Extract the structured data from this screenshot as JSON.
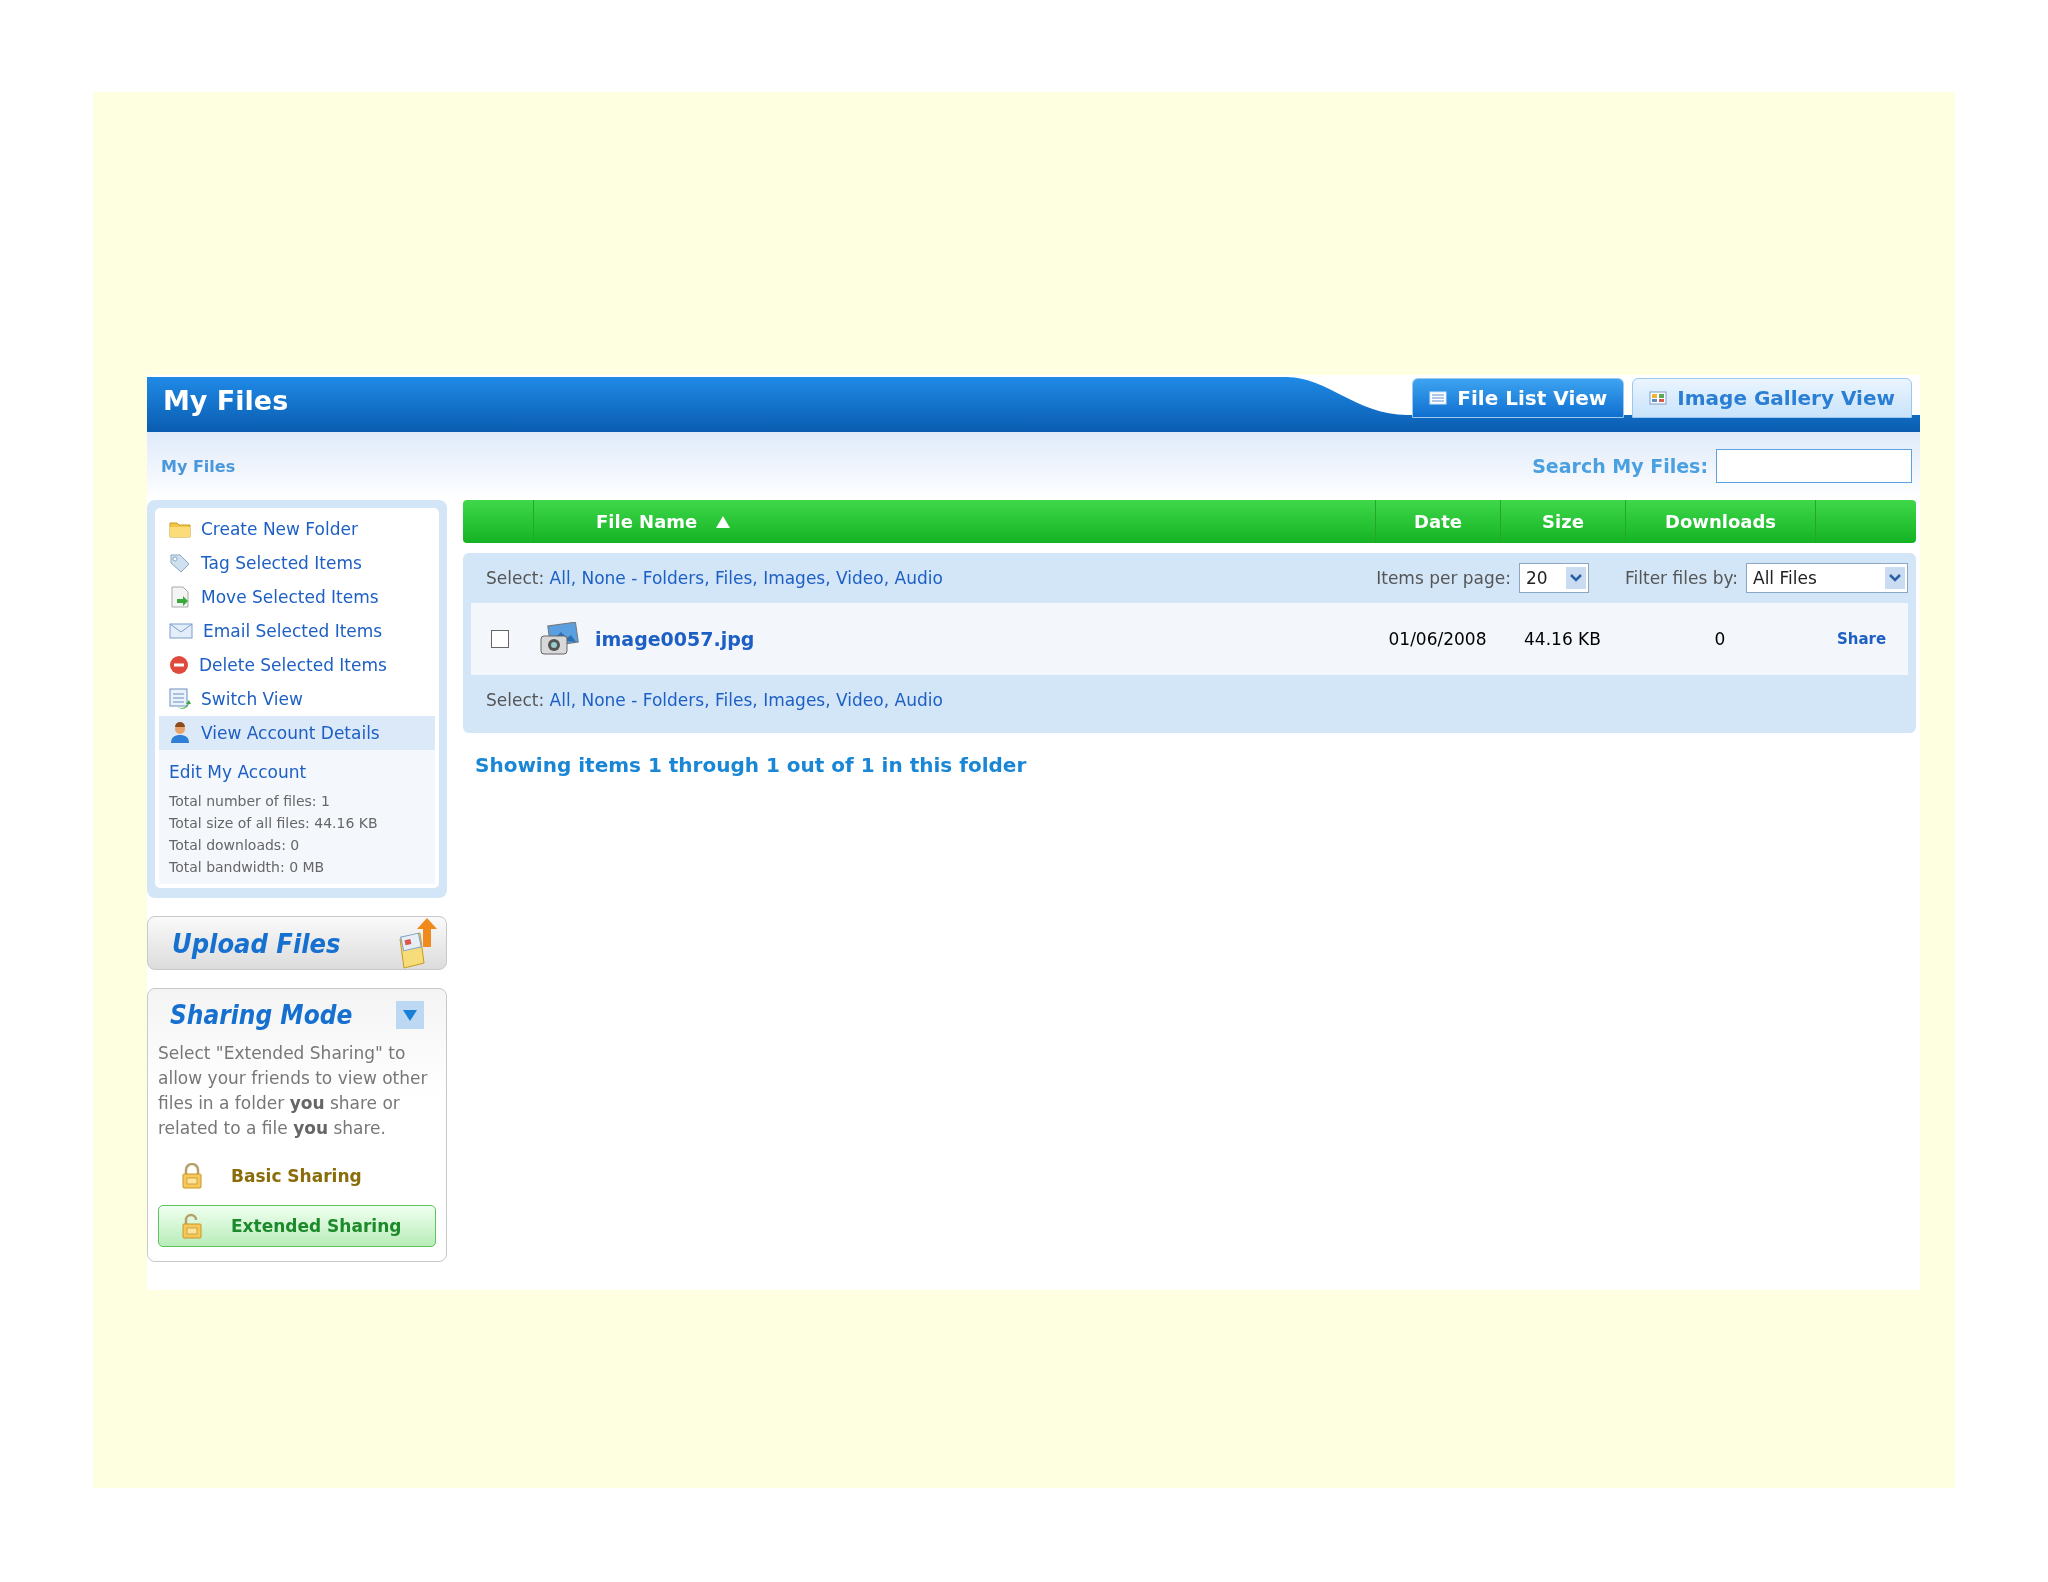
{
  "header": {
    "title": "My Files"
  },
  "tabs": [
    {
      "label": "File List View",
      "selected": true
    },
    {
      "label": "Image Gallery View",
      "selected": false
    }
  ],
  "breadcrumb": "My Files",
  "search": {
    "label": "Search My Files:"
  },
  "sidebar": {
    "items": [
      {
        "label": "Create New Folder",
        "selected": false
      },
      {
        "label": "Tag Selected Items",
        "selected": false
      },
      {
        "label": "Move Selected Items",
        "selected": false
      },
      {
        "label": "Email Selected Items",
        "selected": false
      },
      {
        "label": "Delete Selected Items",
        "selected": false
      },
      {
        "label": "Switch View",
        "selected": false
      },
      {
        "label": "View Account Details",
        "selected": true
      }
    ],
    "account": {
      "link": "Edit My Account",
      "stats": [
        "Total number of files: 1",
        "Total size of all files: 44.16 KB",
        "Total downloads: 0",
        "Total bandwidth: 0 MB"
      ]
    }
  },
  "upload_button": "Upload Files",
  "sharing": {
    "title": "Sharing Mode",
    "description": "Select \"Extended Sharing\" to allow your friends to view other files in a folder **you** share or related to a file **you** share.",
    "options": [
      {
        "label": "Basic Sharing",
        "selected": false
      },
      {
        "label": "Extended Sharing",
        "selected": true
      }
    ]
  },
  "table": {
    "columns": [
      {
        "label": "File Name"
      },
      {
        "label": "Date"
      },
      {
        "label": "Size"
      },
      {
        "label": "Downloads"
      }
    ],
    "select_bars": [
      {
        "label": "Select:",
        "groups": [
          [
            "All",
            "None"
          ],
          [
            "Folders",
            "Files",
            "Images",
            "Video",
            "Audio"
          ]
        ],
        "separator": ",",
        "group_separator": "-"
      },
      {
        "label": "Select:",
        "groups": [
          [
            "All",
            "None"
          ],
          [
            "Folders",
            "Files",
            "Images",
            "Video",
            "Audio"
          ]
        ],
        "separator": ",",
        "group_separator": "-"
      }
    ],
    "items_per_page": {
      "label": "Items per page:",
      "value": "20"
    },
    "filter": {
      "label": "Filter files by:",
      "value": "All Files"
    },
    "rows": [
      {
        "checked": false,
        "name": "image0057.jpg",
        "date": "01/06/2008",
        "size": "44.16 KB",
        "downloads": "0",
        "action": "Share"
      }
    ]
  },
  "status": "Showing items 1 through 1 out of 1 in this folder"
}
